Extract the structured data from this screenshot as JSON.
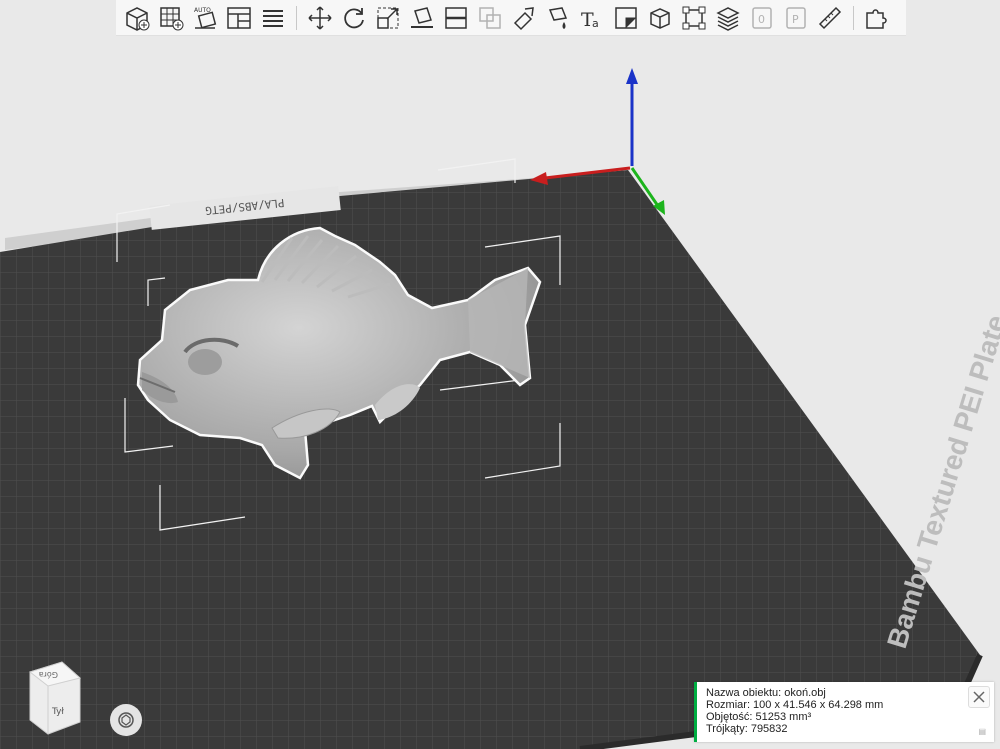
{
  "app": {
    "brand_color": "#00ae42",
    "bed_color": "#3a3a3a"
  },
  "toolbar": {
    "items": [
      {
        "name": "add-object-icon"
      },
      {
        "name": "add-plate-icon"
      },
      {
        "name": "auto-arrange-icon",
        "label": "AUTO"
      },
      {
        "name": "layout-icon"
      },
      {
        "name": "list-icon"
      },
      {
        "name": "move-icon"
      },
      {
        "name": "rotate-icon"
      },
      {
        "name": "scale-icon"
      },
      {
        "name": "lay-on-face-icon"
      },
      {
        "name": "cut-icon"
      },
      {
        "name": "mesh-boolean-icon",
        "disabled": true
      },
      {
        "name": "support-paint-icon"
      },
      {
        "name": "seam-paint-icon"
      },
      {
        "name": "text-icon",
        "label": "Ta"
      },
      {
        "name": "measure-corner-icon"
      },
      {
        "name": "cube-icon"
      },
      {
        "name": "assembly-icon"
      },
      {
        "name": "layers-icon"
      },
      {
        "name": "variable-layer-icon",
        "disabled": true
      },
      {
        "name": "param-icon",
        "disabled": true
      },
      {
        "name": "ruler-icon"
      },
      {
        "name": "puzzle-icon"
      }
    ]
  },
  "plate": {
    "label": "Bambu Textured PEI Plate",
    "filament_label": "PLA/ABS/PETG"
  },
  "view_cube": {
    "top_label": "Góra",
    "back_label": "Tył"
  },
  "object_info": {
    "name_line": "Nazwa obiektu: okoń.obj",
    "size_line": "Rozmiar: 100 x 41.546 x 64.298 mm",
    "volume_line": "Objętość: 51253 mm³",
    "triangles_line": "Trójkąty: 795832"
  }
}
